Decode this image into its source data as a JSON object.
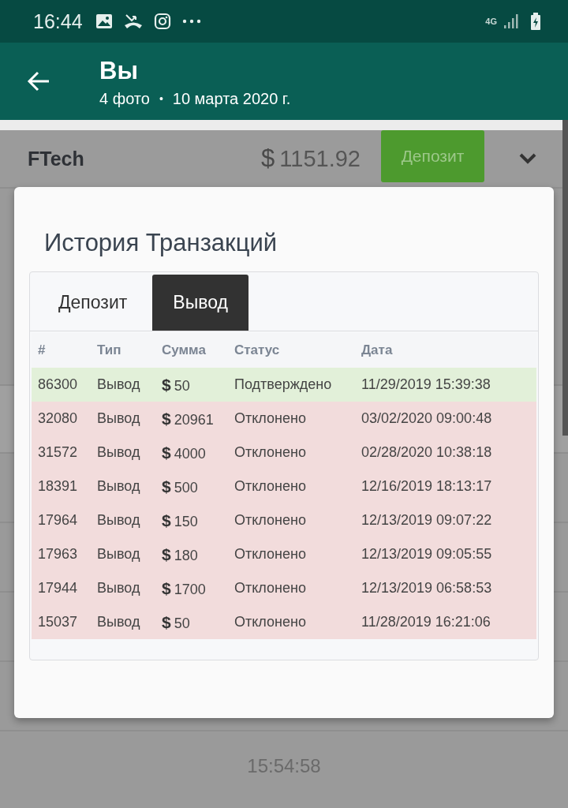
{
  "status_bar": {
    "time": "16:44",
    "network": "4G"
  },
  "app_bar": {
    "title": "Вы",
    "count": "4 фото",
    "separator": "•",
    "date": "10 марта 2020 г."
  },
  "screenshot": {
    "header": {
      "brand": "FTech",
      "currency": "$",
      "balance": "1151.92",
      "deposit_button": "Депозит"
    },
    "footer_time": "15:54:58",
    "dialog": {
      "title": "История Транзакций",
      "tabs": [
        {
          "label": "Депозит",
          "selected": false
        },
        {
          "label": "Вывод",
          "selected": true
        }
      ],
      "table": {
        "columns": [
          "#",
          "Тип",
          "Сумма",
          "Статус",
          "Дата"
        ],
        "rows": [
          {
            "id": "86300",
            "type": "Вывод",
            "currency": "$",
            "amount": "50",
            "status": "Подтверждено",
            "approved": true,
            "date": "11/29/2019 15:39:38"
          },
          {
            "id": "32080",
            "type": "Вывод",
            "currency": "$",
            "amount": "20961",
            "status": "Отклонено",
            "approved": false,
            "date": "03/02/2020 09:00:48"
          },
          {
            "id": "31572",
            "type": "Вывод",
            "currency": "$",
            "amount": "4000",
            "status": "Отклонено",
            "approved": false,
            "date": "02/28/2020 10:38:18"
          },
          {
            "id": "18391",
            "type": "Вывод",
            "currency": "$",
            "amount": "500",
            "status": "Отклонено",
            "approved": false,
            "date": "12/16/2019 18:13:17"
          },
          {
            "id": "17964",
            "type": "Вывод",
            "currency": "$",
            "amount": "150",
            "status": "Отклонено",
            "approved": false,
            "date": "12/13/2019 09:07:22"
          },
          {
            "id": "17963",
            "type": "Вывод",
            "currency": "$",
            "amount": "180",
            "status": "Отклонено",
            "approved": false,
            "date": "12/13/2019 09:05:55"
          },
          {
            "id": "17944",
            "type": "Вывод",
            "currency": "$",
            "amount": "1700",
            "status": "Отклонено",
            "approved": false,
            "date": "12/13/2019 06:58:53"
          },
          {
            "id": "15037",
            "type": "Вывод",
            "currency": "$",
            "amount": "50",
            "status": "Отклонено",
            "approved": false,
            "date": "11/28/2019 16:21:06"
          }
        ]
      }
    }
  }
}
